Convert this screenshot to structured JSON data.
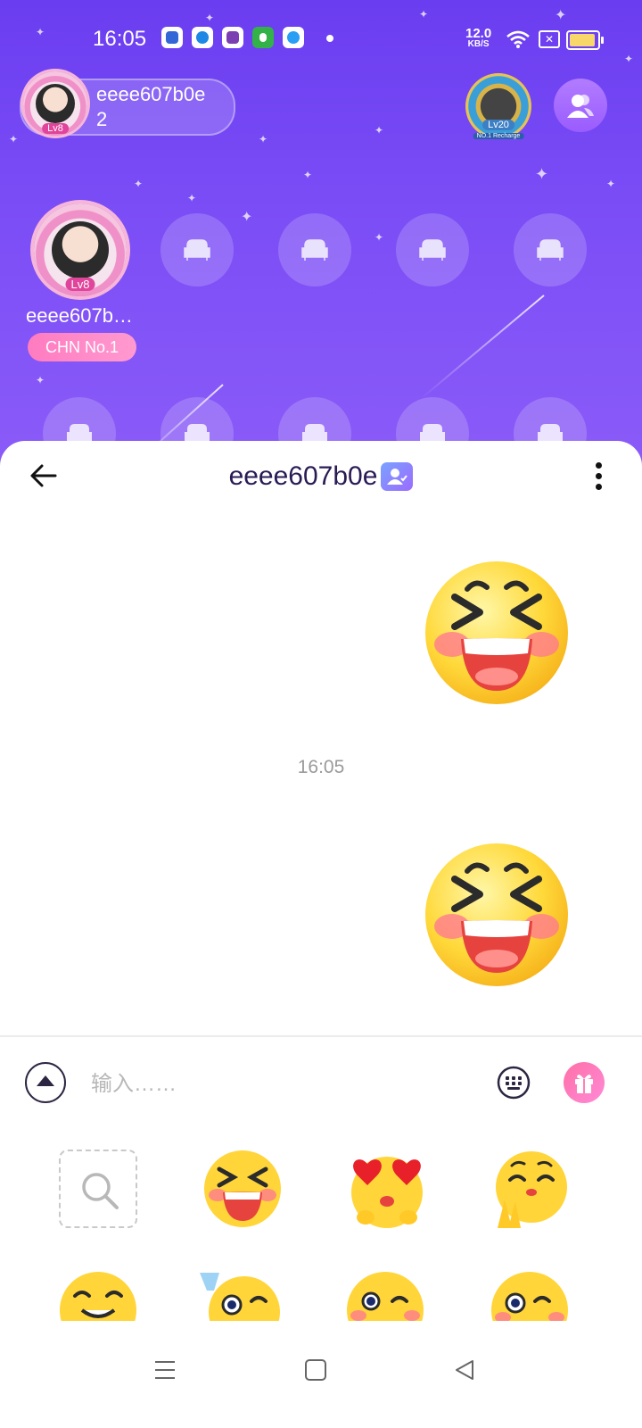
{
  "status_bar": {
    "time": "16:05",
    "network_speed": "12.0",
    "network_unit": "KB/S",
    "icons": [
      "baidu-app-icon",
      "blue-app-icon",
      "purple-app-icon",
      "green-app-icon",
      "qq-browser-icon",
      "notification-dot",
      "wifi-icon",
      "sim-off-icon",
      "battery-icon"
    ]
  },
  "room": {
    "host": {
      "name": "eeee607b0e",
      "count": "2",
      "level": "Lv8"
    },
    "rank_badge": {
      "level": "Lv20",
      "ribbon": "NO.1 Recharge"
    },
    "main_seat": {
      "name": "eeee607b…",
      "level": "Lv8",
      "tag": "CHN No.1"
    },
    "colors": {
      "background_top": "#6a3df0",
      "background_bottom": "#8c5cf8",
      "tag": "#ff7bc0"
    }
  },
  "chat": {
    "title": "eeee607b0e",
    "messages": [
      {
        "type": "sticker",
        "sticker": "laughing-face",
        "side": "right"
      },
      {
        "type": "time",
        "text": "16:05"
      },
      {
        "type": "sticker",
        "sticker": "laughing-face",
        "side": "right"
      }
    ],
    "input": {
      "placeholder": "输入……",
      "value": ""
    }
  },
  "sticker_panel": {
    "row1": [
      "search",
      "laughing-face",
      "heart-eyes-face",
      "praying-face"
    ],
    "row2": [
      "smiling-face",
      "cheers-face",
      "winking-face",
      "monocle-face"
    ]
  },
  "nav_bar": {
    "buttons": [
      "menu",
      "home",
      "back"
    ]
  }
}
